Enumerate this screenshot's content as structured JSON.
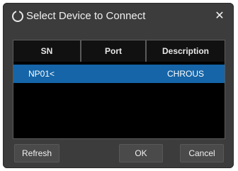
{
  "dialog": {
    "title": "Select Device to Connect",
    "close_glyph": "✕",
    "title_icon": "device-ring-icon",
    "close_icon": "close-icon"
  },
  "table": {
    "columns": [
      "SN",
      "Port",
      "Description"
    ],
    "rows": [
      {
        "sn": "NP01<",
        "port": "",
        "description": "CHROUS",
        "selected": true
      }
    ]
  },
  "buttons": {
    "refresh": "Refresh",
    "ok": "OK",
    "cancel": "Cancel"
  },
  "colors": {
    "dialog_bg": "#3c3c3c",
    "table_bg": "#000000",
    "selection": "#1565a8"
  }
}
